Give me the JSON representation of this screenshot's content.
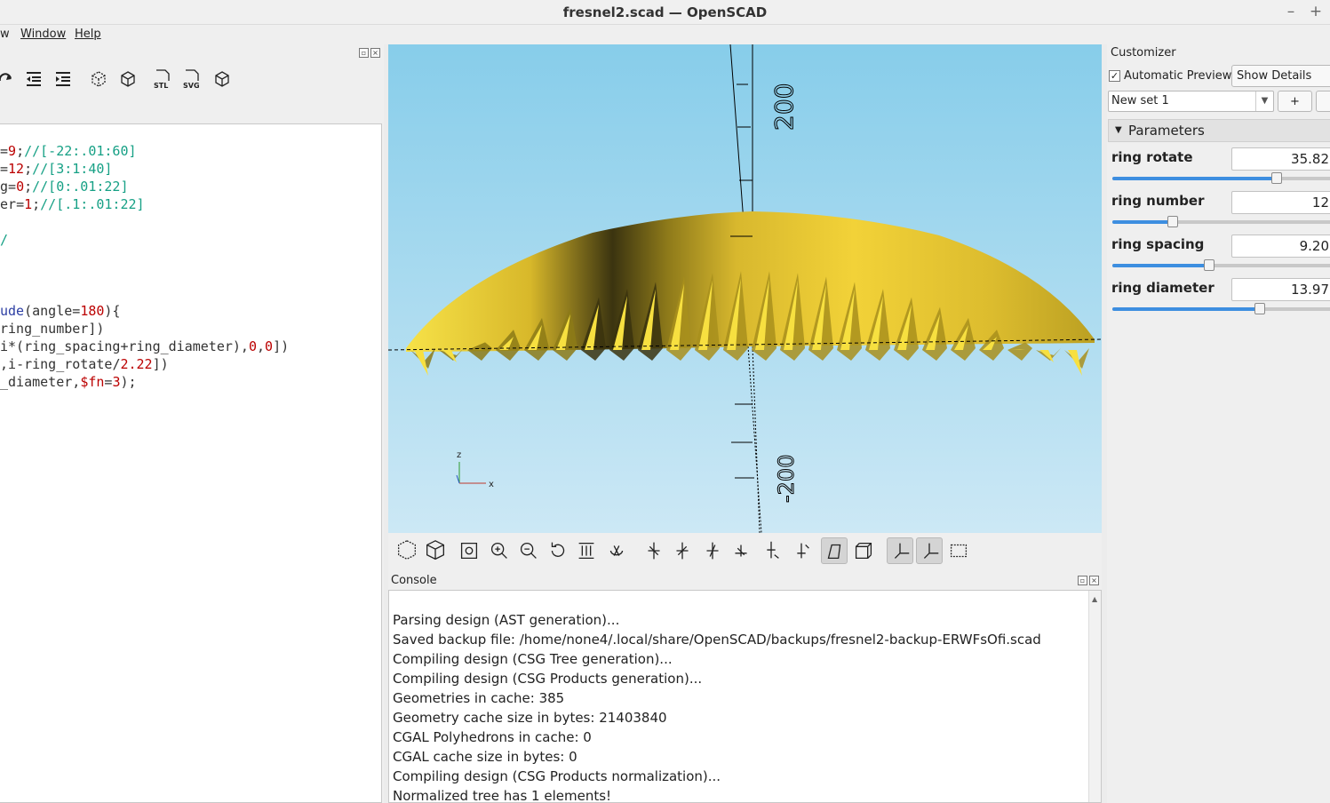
{
  "window": {
    "title": "fresnel2.scad — OpenSCAD",
    "minimize": "–",
    "maximize": "+"
  },
  "menu": {
    "view_partial": "w",
    "window": "Window",
    "help": "Help"
  },
  "editor": {
    "lines": [
      {
        "t": [
          [
            "=",
            "#333"
          ],
          [
            "9",
            "#b00"
          ],
          [
            ";",
            "#333"
          ],
          [
            "//[-22:.01:60]",
            "#16a085"
          ]
        ]
      },
      {
        "t": [
          [
            "=",
            "#333"
          ],
          [
            "12",
            "#b00"
          ],
          [
            ";",
            "#333"
          ],
          [
            "//[3:1:40]",
            "#16a085"
          ]
        ]
      },
      {
        "t": [
          [
            "g",
            "#333"
          ],
          [
            "=",
            "#333"
          ],
          [
            "0",
            "#b00"
          ],
          [
            ";",
            "#333"
          ],
          [
            "//[0:.01:22]",
            "#16a085"
          ]
        ]
      },
      {
        "t": [
          [
            "er",
            "#333"
          ],
          [
            "=",
            "#333"
          ],
          [
            "1",
            "#b00"
          ],
          [
            ";",
            "#333"
          ],
          [
            "//[.1:.01:22]",
            "#16a085"
          ]
        ]
      },
      {
        "t": []
      },
      {
        "t": [
          [
            "/",
            "#16a085"
          ]
        ]
      },
      {
        "t": []
      },
      {
        "t": []
      },
      {
        "t": []
      },
      {
        "t": [
          [
            "ude",
            "#2c3ea3"
          ],
          [
            "(",
            "#333"
          ],
          [
            "angle",
            "#333"
          ],
          [
            "=",
            "#333"
          ],
          [
            "180",
            "#b00"
          ],
          [
            "){",
            "#333"
          ]
        ]
      },
      {
        "t": [
          [
            "ring_number",
            "#333"
          ],
          [
            "])",
            "#333"
          ]
        ]
      },
      {
        "t": [
          [
            "i",
            "#333"
          ],
          [
            "*(",
            "#333"
          ],
          [
            "ring_spacing",
            "#333"
          ],
          [
            "+",
            "#333"
          ],
          [
            "ring_diameter",
            "#333"
          ],
          [
            "),",
            "#333"
          ],
          [
            "0",
            "#b00"
          ],
          [
            ",",
            "#333"
          ],
          [
            "0",
            "#b00"
          ],
          [
            "])",
            "#333"
          ]
        ]
      },
      {
        "t": [
          [
            ",",
            "#333"
          ],
          [
            "i",
            "#333"
          ],
          [
            "-",
            "#333"
          ],
          [
            "ring_rotate",
            "#333"
          ],
          [
            "/",
            "#333"
          ],
          [
            "2.22",
            "#b00"
          ],
          [
            "])",
            "#333"
          ]
        ]
      },
      {
        "t": [
          [
            "_diameter",
            "#333"
          ],
          [
            ",",
            "#333"
          ],
          [
            "$fn",
            "#b00"
          ],
          [
            "=",
            "#333"
          ],
          [
            "3",
            "#b00"
          ],
          [
            ");",
            "#333"
          ]
        ]
      }
    ]
  },
  "viewport": {
    "axis_label_top": "200",
    "axis_label_bottom": "-200",
    "gizmo_z": "z",
    "gizmo_x": "x"
  },
  "console": {
    "header": "Console",
    "lines": [
      "Parsing design (AST generation)...",
      "Saved backup file: /home/none4/.local/share/OpenSCAD/backups/fresnel2-backup-ERWFsOfi.scad",
      "Compiling design (CSG Tree generation)...",
      "Compiling design (CSG Products generation)...",
      "Geometries in cache: 385",
      "Geometry cache size in bytes: 21403840",
      "CGAL Polyhedrons in cache: 0",
      "CGAL cache size in bytes: 0",
      "Compiling design (CSG Products normalization)...",
      "Normalized tree has 1 elements!"
    ]
  },
  "customizer": {
    "title": "Customizer",
    "auto_preview": "Automatic Preview",
    "show_details": "Show Details",
    "preset": "New set 1",
    "add": "+",
    "parameters_header": "Parameters",
    "params": [
      {
        "name": "ring rotate",
        "value": "35.82",
        "fraction": 0.71
      },
      {
        "name": "ring number",
        "value": "12",
        "fraction": 0.26
      },
      {
        "name": "ring spacing",
        "value": "9.20",
        "fraction": 0.42
      },
      {
        "name": "ring diameter",
        "value": "13.97",
        "fraction": 0.64
      }
    ]
  },
  "colors": {
    "model": "#f1d335",
    "sky_top": "#87cdea",
    "sky_bottom": "#cce8f5",
    "accent": "#3d8ee0"
  }
}
